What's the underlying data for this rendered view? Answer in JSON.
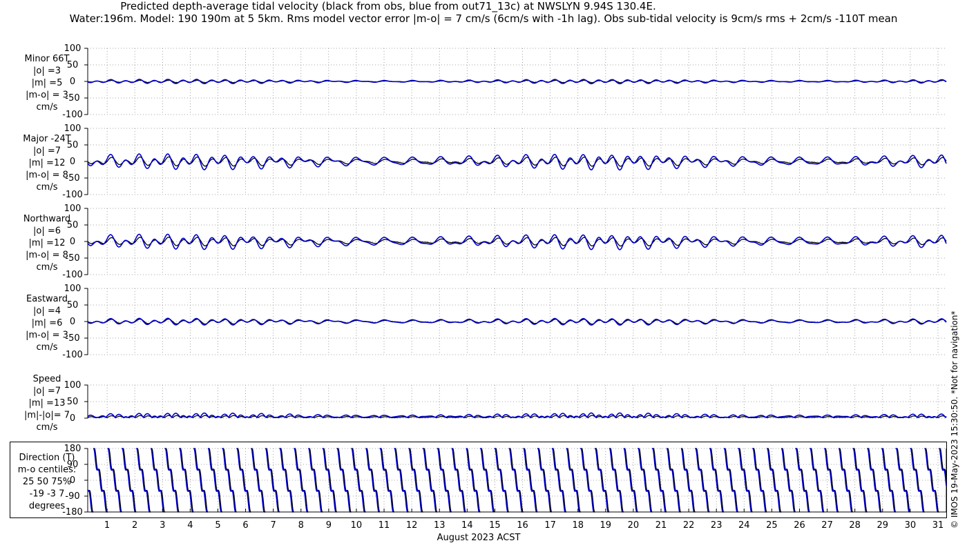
{
  "title_line1": "Predicted depth-average tidal velocity (black from obs, blue from out71_13c) at NWSLYN 9.94S 130.4E.",
  "title_line2": "Water:196m. Model: 190 190m at 5 5km. Rms model vector error |m-o| = 7 cm/s (6cm/s with -1h lag). Obs sub-tidal velocity is 9cm/s rms + 2cm/s -110T mean",
  "side_note": "© IMOS 19-May-2023 15:30:50.  *Not for navigation*",
  "colors": {
    "obs": "#000000",
    "model": "#0000cc",
    "grid": "#888888"
  },
  "chart_data": [
    {
      "type": "line",
      "panel": "minor",
      "label_lines": [
        "Minor 66T",
        "|o| =3",
        "|m| =5",
        "|m-o| = 3",
        "cm/s"
      ],
      "yticks": [
        100,
        50,
        0,
        -50,
        -100
      ],
      "ylim": [
        -100,
        100
      ],
      "series": [
        {
          "key": "obs",
          "semi": 3,
          "di": 1,
          "phase": 0.0
        },
        {
          "key": "model",
          "semi": 5,
          "di": 2,
          "phase": 0.3
        }
      ]
    },
    {
      "type": "line",
      "panel": "major",
      "label_lines": [
        "Major -24T",
        "|o| =7",
        "|m| =12",
        "|m-o| = 8",
        "cm/s"
      ],
      "yticks": [
        100,
        50,
        0,
        -50,
        -100
      ],
      "ylim": [
        -100,
        100
      ],
      "series": [
        {
          "key": "obs",
          "semi": 10,
          "di": 5,
          "phase": 0.0
        },
        {
          "key": "model",
          "semi": 16,
          "di": 10,
          "phase": 0.35
        }
      ]
    },
    {
      "type": "line",
      "panel": "north",
      "label_lines": [
        "Northward",
        "|o| =6",
        "|m| =12",
        "|m-o| = 8",
        "cm/s"
      ],
      "yticks": [
        100,
        50,
        0,
        -50,
        -100
      ],
      "ylim": [
        -100,
        100
      ],
      "series": [
        {
          "key": "obs",
          "semi": 9,
          "di": 5,
          "phase": 0.0
        },
        {
          "key": "model",
          "semi": 15,
          "di": 10,
          "phase": 0.35
        }
      ]
    },
    {
      "type": "line",
      "panel": "east",
      "label_lines": [
        "Eastward",
        "|o| =4",
        "|m| =6",
        "|m-o| = 3",
        "cm/s"
      ],
      "yticks": [
        100,
        50,
        0,
        -50,
        -100
      ],
      "ylim": [
        -100,
        100
      ],
      "series": [
        {
          "key": "obs",
          "semi": 5,
          "di": 3,
          "phase": 0.0
        },
        {
          "key": "model",
          "semi": 7,
          "di": 4,
          "phase": 0.3
        }
      ]
    },
    {
      "type": "line",
      "panel": "speed",
      "label_lines": [
        "Speed",
        "|o| =7",
        "|m| =13",
        "|m|-|o|= 7",
        "cm/s"
      ],
      "yticks": [
        100,
        50,
        0
      ],
      "ylim": [
        0,
        100
      ],
      "series": [
        {
          "key": "obs",
          "semi": 8,
          "di": 4,
          "phase": 0.0
        },
        {
          "key": "model",
          "semi": 14,
          "di": 9,
          "phase": 0.35
        }
      ]
    },
    {
      "type": "line",
      "panel": "direction",
      "label_lines": [
        "Direction (T)",
        "m-o centiles:",
        "25  50  75%",
        "-19  -3   7",
        "degrees"
      ],
      "yticks": [
        180,
        90,
        0,
        -90,
        -180
      ],
      "ylim": [
        -180,
        180
      ],
      "series": [
        {
          "key": "obs"
        },
        {
          "key": "model"
        }
      ]
    }
  ],
  "x_axis": {
    "label": "August 2023 ACST",
    "ticks": [
      1,
      2,
      3,
      4,
      5,
      6,
      7,
      8,
      9,
      10,
      11,
      12,
      13,
      14,
      15,
      16,
      17,
      18,
      19,
      20,
      21,
      22,
      23,
      24,
      25,
      26,
      27,
      28,
      29,
      30,
      31
    ],
    "xlim_days": [
      0.3,
      31.3
    ]
  }
}
